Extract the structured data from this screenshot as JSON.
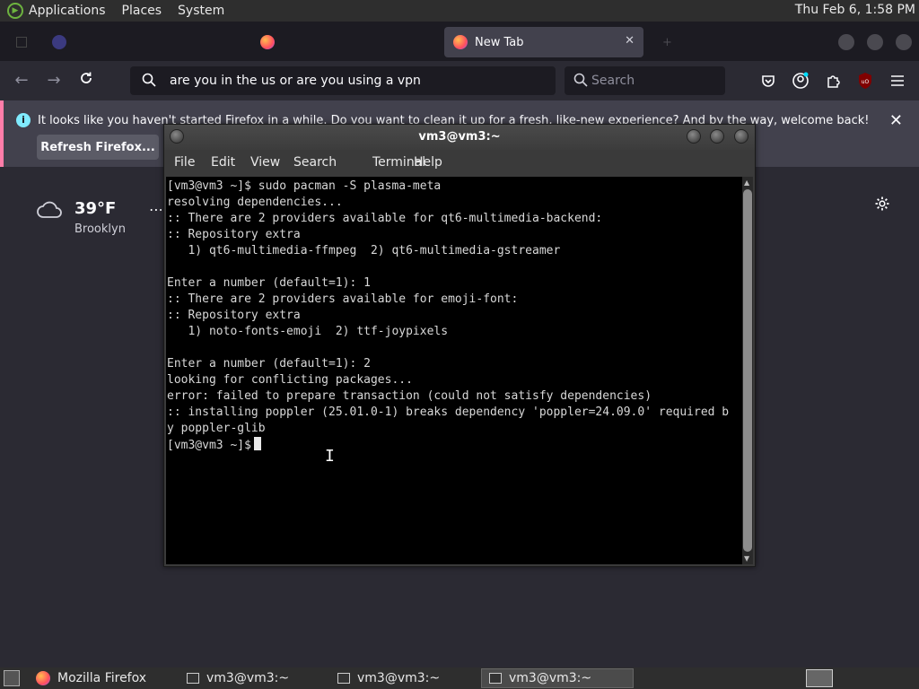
{
  "top_panel": {
    "menus": [
      "Applications",
      "Places",
      "System"
    ],
    "clock": "Thu Feb  6,  1:58 PM"
  },
  "firefox": {
    "tabs": [
      {
        "label": "",
        "active": false
      },
      {
        "label": "",
        "active": false
      },
      {
        "label": "New Tab",
        "active": true
      }
    ],
    "url": "are you in the us or are you using a vpn",
    "search_placeholder": "Search",
    "notice": {
      "message": "It looks like you haven't started Firefox in a while. Do you want to clean it up for a fresh, like-new experience? And by the way, welcome back!",
      "button": "Refresh Firefox..."
    },
    "weather": {
      "temperature": "39°F",
      "city": "Brooklyn"
    }
  },
  "terminal": {
    "title": "vm3@vm3:~",
    "menu": [
      "File",
      "Edit",
      "View",
      "Search",
      "Terminal",
      "Help"
    ],
    "lines": [
      "[vm3@vm3 ~]$ sudo pacman -S plasma-meta",
      "resolving dependencies...",
      ":: There are 2 providers available for qt6-multimedia-backend:",
      ":: Repository extra",
      "   1) qt6-multimedia-ffmpeg  2) qt6-multimedia-gstreamer",
      "",
      "Enter a number (default=1): 1",
      ":: There are 2 providers available for emoji-font:",
      ":: Repository extra",
      "   1) noto-fonts-emoji  2) ttf-joypixels",
      "",
      "Enter a number (default=1): 2",
      "looking for conflicting packages...",
      "error: failed to prepare transaction (could not satisfy dependencies)",
      ":: installing poppler (25.01.0-1) breaks dependency 'poppler=24.09.0' required b",
      "y poppler-glib"
    ],
    "prompt": "[vm3@vm3 ~]$"
  },
  "taskbar": {
    "tasks": [
      {
        "label": "Mozilla Firefox",
        "icon": "firefox-icon",
        "active": false
      },
      {
        "label": "vm3@vm3:~",
        "icon": "terminal-icon",
        "active": false
      },
      {
        "label": "vm3@vm3:~",
        "icon": "terminal-icon",
        "active": false
      },
      {
        "label": "vm3@vm3:~",
        "icon": "terminal-icon",
        "active": true
      }
    ]
  }
}
